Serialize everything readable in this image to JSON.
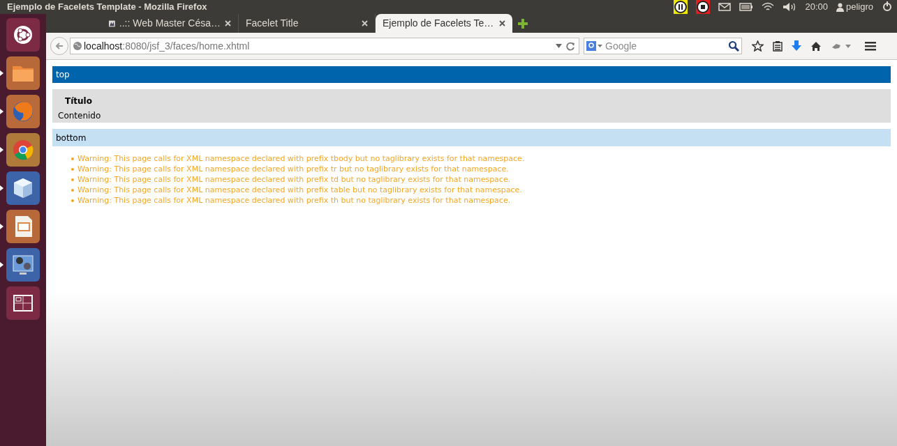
{
  "panel": {
    "title": "Ejemplo de Facelets Template - Mozilla Firefox",
    "clock": "20:00",
    "user": "peligro"
  },
  "launcher": [
    {
      "kind": "ubuntu",
      "running": false
    },
    {
      "kind": "files",
      "running": true
    },
    {
      "kind": "firefox",
      "running": true
    },
    {
      "kind": "chrome",
      "running": true
    },
    {
      "kind": "cube",
      "running": true
    },
    {
      "kind": "impress",
      "running": true
    },
    {
      "kind": "video",
      "running": true
    },
    {
      "kind": "workspaces",
      "running": false
    }
  ],
  "tabs": [
    {
      "label": "..:: Web Master Césa…",
      "selected": false,
      "favicon": true
    },
    {
      "label": "Facelet Title",
      "selected": false,
      "favicon": false
    },
    {
      "label": "Ejemplo de Facelets Te…",
      "selected": true,
      "favicon": false
    }
  ],
  "address_bar": {
    "host": "localhost",
    "path": ":8080/jsf_3/faces/home.xhtml"
  },
  "search": {
    "placeholder": "Google"
  },
  "page": {
    "top": "top",
    "titulo": "Título",
    "contenido": "Contenido",
    "bottom": "bottom",
    "warnings": [
      "Warning: This page calls for XML namespace declared with prefix tbody but no taglibrary exists for that namespace.",
      "Warning: This page calls for XML namespace declared with prefix tr but no taglibrary exists for that namespace.",
      "Warning: This page calls for XML namespace declared with prefix td but no taglibrary exists for that namespace.",
      "Warning: This page calls for XML namespace declared with prefix table but no taglibrary exists for that namespace.",
      "Warning: This page calls for XML namespace declared with prefix th but no taglibrary exists for that namespace."
    ]
  }
}
